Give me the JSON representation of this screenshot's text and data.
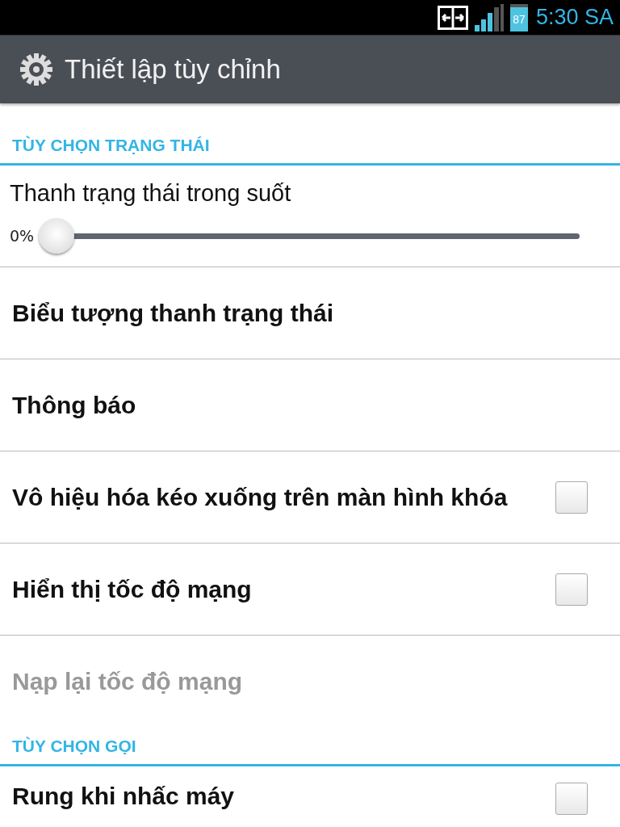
{
  "status_bar": {
    "battery": "87",
    "time": "5:30 SA"
  },
  "header": {
    "title": "Thiết lập tùy chỉnh"
  },
  "sections": [
    {
      "title": "TÙY CHỌN TRẠNG THÁI",
      "items": [
        {
          "kind": "slider",
          "label": "Thanh trạng thái trong suốt",
          "reading": "0%",
          "level": 0,
          "disabled": false
        },
        {
          "kind": "link",
          "label": "Biểu tượng thanh trạng thái",
          "disabled": false
        },
        {
          "kind": "link",
          "label": "Thông báo",
          "disabled": false
        },
        {
          "kind": "checkbox",
          "label": "Vô hiệu hóa kéo xuống trên màn hình khóa",
          "checked": false,
          "disabled": false
        },
        {
          "kind": "checkbox",
          "label": "Hiển thị tốc độ mạng",
          "checked": false,
          "disabled": false
        },
        {
          "kind": "link",
          "label": "Nạp lại tốc độ mạng",
          "disabled": true
        }
      ]
    },
    {
      "title": "TÙY CHỌN GỌI",
      "items": [
        {
          "kind": "checkbox",
          "label": "Rung khi nhấc máy",
          "checked": false,
          "disabled": false
        }
      ]
    }
  ]
}
